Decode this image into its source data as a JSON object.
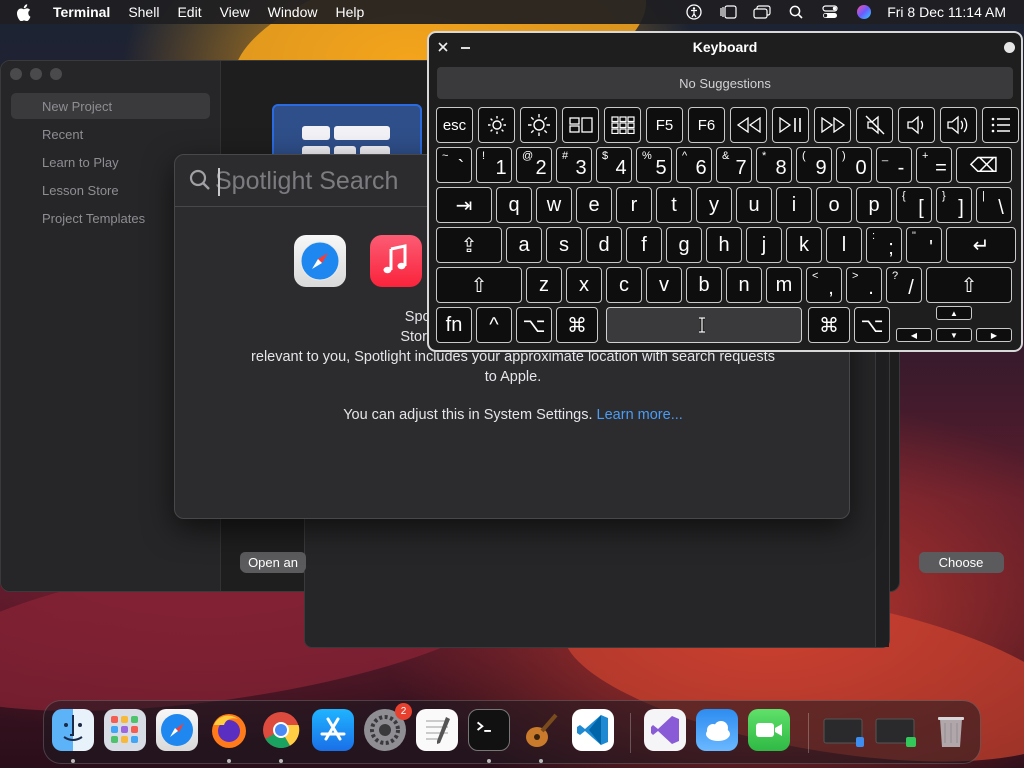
{
  "menubar": {
    "app_name": "Terminal",
    "items": [
      "Shell",
      "Edit",
      "View",
      "Window",
      "Help"
    ],
    "clock": "Fri 8 Dec  11:14 AM"
  },
  "xcode": {
    "sidebar": [
      "New Project",
      "Recent",
      "Learn to Play",
      "Lesson Store",
      "Project Templates"
    ],
    "open_button": "Open an",
    "choose_button": "Choose"
  },
  "spotlight": {
    "placeholder": "Spotlight Search",
    "body": "Spotlight now shows pers… Store, movie showtimes, lo… relevant to you, Spotlight includes your approximate location with search requests to Apple.",
    "body_lines": [
      "Spotlight now shows pers",
      "Store, movie showtimes, lo",
      "relevant to you, Spotlight includes your approximate location with search requests",
      "to Apple."
    ],
    "adjust_text": "You can adjust this in System Settings.",
    "learn_more": "Learn more..."
  },
  "keyboard": {
    "title": "Keyboard",
    "suggestions": "No Suggestions",
    "fn_row": [
      "esc",
      "brightness-down-icon",
      "brightness-up-icon",
      "mission-control-icon",
      "launchpad-icon",
      "F5",
      "F6",
      "rewind-icon",
      "play-pause-icon",
      "fast-forward-icon",
      "mute-icon",
      "volume-down-icon",
      "volume-up-icon",
      "list-icon"
    ],
    "number_row": [
      {
        "sup": "~",
        "main": "`"
      },
      {
        "sup": "!",
        "main": "1"
      },
      {
        "sup": "@",
        "main": "2"
      },
      {
        "sup": "#",
        "main": "3"
      },
      {
        "sup": "$",
        "main": "4"
      },
      {
        "sup": "%",
        "main": "5"
      },
      {
        "sup": "^",
        "main": "6"
      },
      {
        "sup": "&",
        "main": "7"
      },
      {
        "sup": "*",
        "main": "8"
      },
      {
        "sup": "(",
        "main": "9"
      },
      {
        "sup": ")",
        "main": "0"
      },
      {
        "sup": "_",
        "main": "-"
      },
      {
        "sup": "+",
        "main": "="
      }
    ],
    "qwerty_row": [
      "q",
      "w",
      "e",
      "r",
      "t",
      "y",
      "u",
      "i",
      "o",
      "p"
    ],
    "qwerty_symbols": [
      {
        "sup": "{",
        "main": "["
      },
      {
        "sup": "}",
        "main": "]"
      },
      {
        "sup": "|",
        "main": "\\"
      }
    ],
    "home_row": [
      "a",
      "s",
      "d",
      "f",
      "g",
      "h",
      "j",
      "k",
      "l"
    ],
    "home_symbols": [
      {
        "sup": ":",
        "main": ";"
      },
      {
        "sup": "\"",
        "main": "'"
      }
    ],
    "bottom_row": [
      "z",
      "x",
      "c",
      "v",
      "b",
      "n",
      "m"
    ],
    "bottom_symbols": [
      {
        "sup": "<",
        "main": ","
      },
      {
        "sup": ">",
        "main": "."
      },
      {
        "sup": "?",
        "main": "/"
      }
    ],
    "modifiers": {
      "fn": "fn",
      "control": "^",
      "option": "⌥",
      "command": "⌘",
      "tab": "⇥",
      "caps": "⇪",
      "shift": "⇧",
      "return": "↵",
      "delete": "⌫"
    }
  },
  "dock": {
    "apps": [
      "finder-icon",
      "launchpad-icon",
      "safari-icon",
      "firefox-icon",
      "chrome-icon",
      "app-store-icon",
      "system-settings-icon",
      "textedit-icon",
      "terminal-icon",
      "garageband-icon",
      "vscode-icon",
      "visual-studio-icon",
      "weather-icon",
      "facetime-icon",
      "recent-window-icon",
      "recent-window-icon",
      "trash-icon"
    ],
    "settings_badge": "2"
  }
}
